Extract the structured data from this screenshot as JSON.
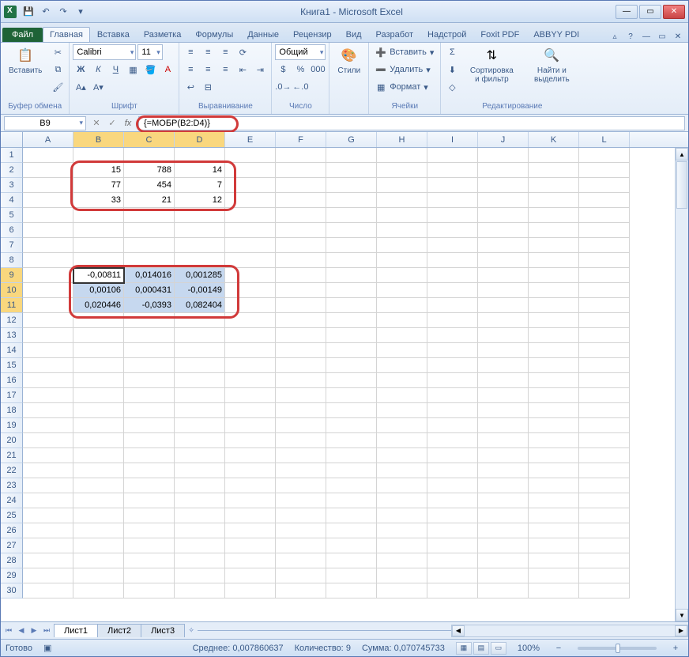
{
  "title": "Книга1 - Microsoft Excel",
  "qat": {
    "save": "💾",
    "undo": "↶",
    "redo": "↷",
    "dd": "▾"
  },
  "tabs": {
    "file": "Файл",
    "list": [
      "Главная",
      "Вставка",
      "Разметка",
      "Формулы",
      "Данные",
      "Рецензир",
      "Вид",
      "Разработ",
      "Надстрой",
      "Foxit PDF",
      "ABBYY PDI"
    ],
    "active": 0
  },
  "ribbon": {
    "clipboard": {
      "paste": "Вставить",
      "label": "Буфер обмена"
    },
    "font": {
      "name": "Calibri",
      "size": "11",
      "label": "Шрифт"
    },
    "align": {
      "label": "Выравнивание"
    },
    "number": {
      "format": "Общий",
      "label": "Число"
    },
    "styles": {
      "btn": "Стили",
      "label": ""
    },
    "cells": {
      "insert": "Вставить",
      "delete": "Удалить",
      "format": "Формат",
      "label": "Ячейки"
    },
    "editing": {
      "sort": "Сортировка и фильтр",
      "find": "Найти и выделить",
      "label": "Редактирование"
    }
  },
  "namebox": "B9",
  "formula": "{=МОБР(B2:D4)}",
  "columns": [
    "A",
    "B",
    "C",
    "D",
    "E",
    "F",
    "G",
    "H",
    "I",
    "J",
    "K",
    "L"
  ],
  "rows_count": 30,
  "matrix1": [
    [
      "15",
      "788",
      "14"
    ],
    [
      "77",
      "454",
      "7"
    ],
    [
      "33",
      "21",
      "12"
    ]
  ],
  "matrix2": [
    [
      "-0,00811",
      "0,014016",
      "0,001285"
    ],
    [
      "0,00106",
      "0,000431",
      "-0,00149"
    ],
    [
      "0,020446",
      "-0,0393",
      "0,082404"
    ]
  ],
  "sheets": [
    "Лист1",
    "Лист2",
    "Лист3"
  ],
  "status": {
    "ready": "Готово",
    "avg_label": "Среднее:",
    "avg": "0,007860637",
    "count_label": "Количество:",
    "count": "9",
    "sum_label": "Сумма:",
    "sum": "0,070745733",
    "zoom": "100%"
  }
}
